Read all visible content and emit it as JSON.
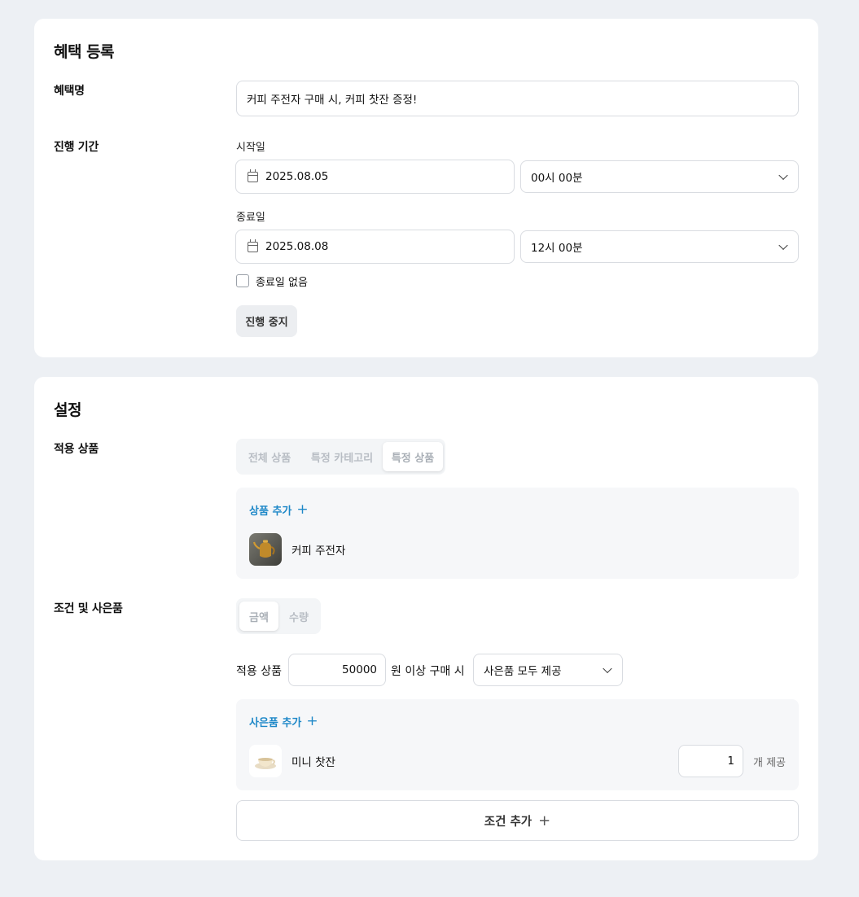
{
  "benefit_section": {
    "title": "혜택 등록",
    "name_label": "혜택명",
    "name_value": "커피 주전자 구매 시, 커피 찻잔 증정!",
    "period_label": "진행 기간",
    "start_label": "시작일",
    "start_date": "2025.08.05",
    "start_time": "00시 00분",
    "end_label": "종료일",
    "end_date": "2025.08.08",
    "end_time": "12시 00분",
    "no_end_label": "종료일 없음",
    "stop_button": "진행 중지"
  },
  "settings_section": {
    "title": "설정",
    "products_label": "적용 상품",
    "product_tabs": [
      "전체 상품",
      "특정 카테고리",
      "특정 상품"
    ],
    "active_product_tab": "특정 상품",
    "add_product": "상품 추가",
    "products": [
      {
        "name": "커피 주전자",
        "icon": "coffee-kettle-thumbnail"
      }
    ],
    "conditions_label": "조건 및 사은품",
    "condition_tabs": [
      "금액",
      "수량"
    ],
    "active_condition_tab": "금액",
    "condition_prefix": "적용 상품",
    "condition_amount": "50000",
    "condition_suffix": "원 이상 구매 시",
    "gift_mode": "사은품 모두 제공",
    "add_gift": "사은품 추가",
    "gifts": [
      {
        "name": "미니 찻잔",
        "qty": "1",
        "unit": "개 제공",
        "icon": "teacup-thumbnail"
      }
    ],
    "add_condition": "조건 추가"
  },
  "colors": {
    "background": "#edf0f4",
    "card": "#ffffff",
    "accent_blue": "#1e88c8",
    "border": "#d9dce1"
  }
}
